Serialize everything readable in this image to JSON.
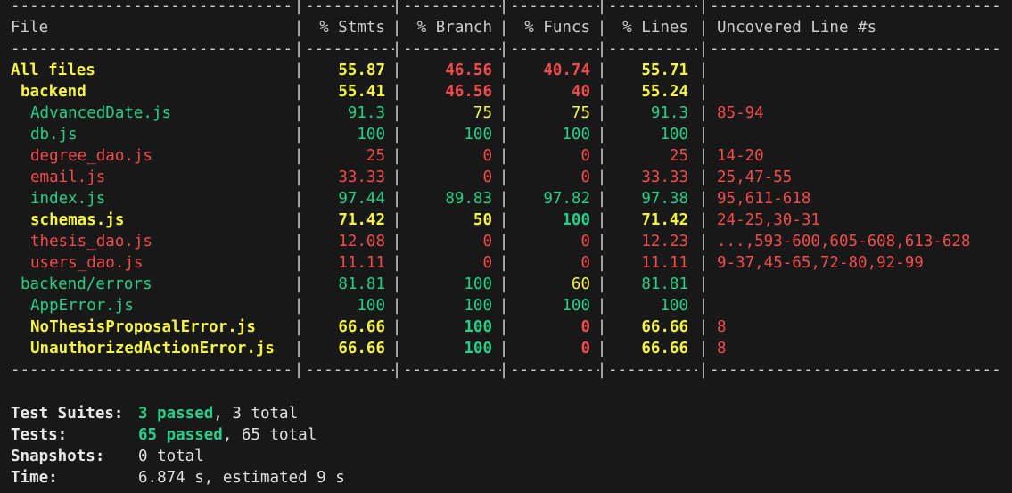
{
  "colors": {
    "background": "#181818",
    "default_text": "#cccccc",
    "high": "#23d18b",
    "medium": "#f5f543",
    "low": "#f14c4c"
  },
  "dash_line": "-----------------------------------------------------------------------------------",
  "header": {
    "file": "File",
    "stmts": "% Stmts",
    "branch": "% Branch",
    "funcs": "% Funcs",
    "lines": "% Lines",
    "uncovered": "Uncovered Line #s"
  },
  "rows": [
    {
      "file": "All files",
      "indent": 0,
      "bold": true,
      "file_color": "medium",
      "stmts": "55.87",
      "stmts_color": "medium",
      "branch": "46.56",
      "branch_color": "low",
      "funcs": "40.74",
      "funcs_color": "low",
      "lines": "55.71",
      "lines_color": "medium",
      "uncovered": "",
      "uncovered_color": "low"
    },
    {
      "file": "backend",
      "indent": 1,
      "bold": true,
      "file_color": "medium",
      "stmts": "55.41",
      "stmts_color": "medium",
      "branch": "46.56",
      "branch_color": "low",
      "funcs": "40",
      "funcs_color": "low",
      "lines": "55.24",
      "lines_color": "medium",
      "uncovered": "",
      "uncovered_color": "low"
    },
    {
      "file": "AdvancedDate.js",
      "indent": 2,
      "bold": false,
      "file_color": "high",
      "stmts": "91.3",
      "stmts_color": "high",
      "branch": "75",
      "branch_color": "medium",
      "funcs": "75",
      "funcs_color": "medium",
      "lines": "91.3",
      "lines_color": "high",
      "uncovered": "85-94",
      "uncovered_color": "low"
    },
    {
      "file": "db.js",
      "indent": 2,
      "bold": false,
      "file_color": "high",
      "stmts": "100",
      "stmts_color": "high",
      "branch": "100",
      "branch_color": "high",
      "funcs": "100",
      "funcs_color": "high",
      "lines": "100",
      "lines_color": "high",
      "uncovered": "",
      "uncovered_color": "low"
    },
    {
      "file": "degree_dao.js",
      "indent": 2,
      "bold": false,
      "file_color": "low",
      "stmts": "25",
      "stmts_color": "low",
      "branch": "0",
      "branch_color": "low",
      "funcs": "0",
      "funcs_color": "low",
      "lines": "25",
      "lines_color": "low",
      "uncovered": "14-20",
      "uncovered_color": "low"
    },
    {
      "file": "email.js",
      "indent": 2,
      "bold": false,
      "file_color": "low",
      "stmts": "33.33",
      "stmts_color": "low",
      "branch": "0",
      "branch_color": "low",
      "funcs": "0",
      "funcs_color": "low",
      "lines": "33.33",
      "lines_color": "low",
      "uncovered": "25,47-55",
      "uncovered_color": "low"
    },
    {
      "file": "index.js",
      "indent": 2,
      "bold": false,
      "file_color": "high",
      "stmts": "97.44",
      "stmts_color": "high",
      "branch": "89.83",
      "branch_color": "high",
      "funcs": "97.82",
      "funcs_color": "high",
      "lines": "97.38",
      "lines_color": "high",
      "uncovered": "95,611-618",
      "uncovered_color": "low"
    },
    {
      "file": "schemas.js",
      "indent": 2,
      "bold": true,
      "file_color": "medium",
      "stmts": "71.42",
      "stmts_color": "medium",
      "branch": "50",
      "branch_color": "medium",
      "funcs": "100",
      "funcs_color": "high",
      "lines": "71.42",
      "lines_color": "medium",
      "uncovered": "24-25,30-31",
      "uncovered_color": "low"
    },
    {
      "file": "thesis_dao.js",
      "indent": 2,
      "bold": false,
      "file_color": "low",
      "stmts": "12.08",
      "stmts_color": "low",
      "branch": "0",
      "branch_color": "low",
      "funcs": "0",
      "funcs_color": "low",
      "lines": "12.23",
      "lines_color": "low",
      "uncovered": "...,593-600,605-608,613-628",
      "uncovered_color": "low"
    },
    {
      "file": "users_dao.js",
      "indent": 2,
      "bold": false,
      "file_color": "low",
      "stmts": "11.11",
      "stmts_color": "low",
      "branch": "0",
      "branch_color": "low",
      "funcs": "0",
      "funcs_color": "low",
      "lines": "11.11",
      "lines_color": "low",
      "uncovered": "9-37,45-65,72-80,92-99",
      "uncovered_color": "low"
    },
    {
      "file": "backend/errors",
      "indent": 1,
      "bold": false,
      "file_color": "high",
      "stmts": "81.81",
      "stmts_color": "high",
      "branch": "100",
      "branch_color": "high",
      "funcs": "60",
      "funcs_color": "medium",
      "lines": "81.81",
      "lines_color": "high",
      "uncovered": "",
      "uncovered_color": "low"
    },
    {
      "file": "AppError.js",
      "indent": 2,
      "bold": false,
      "file_color": "high",
      "stmts": "100",
      "stmts_color": "high",
      "branch": "100",
      "branch_color": "high",
      "funcs": "100",
      "funcs_color": "high",
      "lines": "100",
      "lines_color": "high",
      "uncovered": "",
      "uncovered_color": "low"
    },
    {
      "file": "NoThesisProposalError.js",
      "indent": 2,
      "bold": true,
      "file_color": "medium",
      "stmts": "66.66",
      "stmts_color": "medium",
      "branch": "100",
      "branch_color": "high",
      "funcs": "0",
      "funcs_color": "low",
      "lines": "66.66",
      "lines_color": "medium",
      "uncovered": "8",
      "uncovered_color": "low"
    },
    {
      "file": "UnauthorizedActionError.js",
      "indent": 2,
      "bold": true,
      "file_color": "medium",
      "stmts": "66.66",
      "stmts_color": "medium",
      "branch": "100",
      "branch_color": "high",
      "funcs": "0",
      "funcs_color": "low",
      "lines": "66.66",
      "lines_color": "medium",
      "uncovered": "8",
      "uncovered_color": "low"
    }
  ],
  "summary": {
    "suites_label": "Test Suites:",
    "suites_passed": "3 passed",
    "suites_total": ", 3 total",
    "tests_label": "Tests:",
    "tests_passed": "65 passed",
    "tests_total": ", 65 total",
    "snapshots_label": "Snapshots:",
    "snapshots_value": "0 total",
    "time_label": "Time:",
    "time_value": "6.874 s, estimated 9 s"
  }
}
